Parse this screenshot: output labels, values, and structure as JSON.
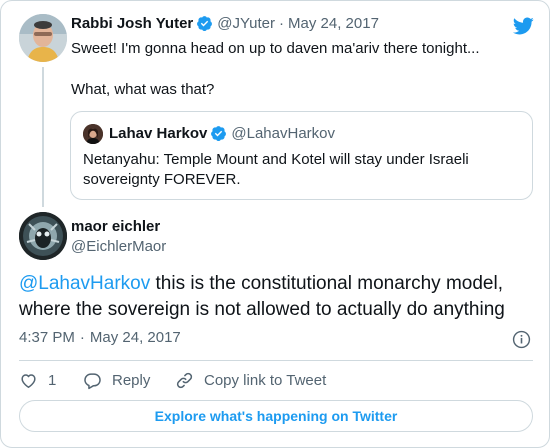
{
  "colors": {
    "accent": "#1d9bf0",
    "text": "#0f1419",
    "muted": "#536471",
    "border": "#cfd9de"
  },
  "parent_tweet": {
    "display_name": "Rabbi Josh Yuter",
    "handle": "@JYuter",
    "separator": "·",
    "date": "May 24, 2017",
    "verified_icon": "verified-badge-icon",
    "text_line_1": "Sweet! I'm gonna head on up to daven ma'ariv there tonight...",
    "text_line_2": "What, what was that?"
  },
  "quoted_tweet": {
    "display_name": "Lahav Harkov",
    "handle": "@LahavHarkov",
    "verified_icon": "verified-badge-icon",
    "text_line_1": "Netanyahu: Temple Mount and Kotel will stay under Israeli",
    "text_line_2": "sovereignty FOREVER."
  },
  "main_tweet": {
    "display_name": "maor eichler",
    "handle": "@EichlerMaor",
    "mention": "@LahavHarkov",
    "text_line_1_rest": " this is the constitutional monarchy model,",
    "text_line_2": "where the sovereign is not allowed to actually do anything",
    "time": "4:37 PM",
    "separator": "·",
    "date": "May 24, 2017"
  },
  "actions": {
    "like_count": "1",
    "reply_label": "Reply",
    "copy_link_label": "Copy link to Tweet"
  },
  "explore_button_label": "Explore what's happening on Twitter",
  "icons": [
    "twitter-bird-icon",
    "verified-badge-icon",
    "info-icon",
    "heart-icon",
    "reply-bubble-icon",
    "link-icon"
  ]
}
